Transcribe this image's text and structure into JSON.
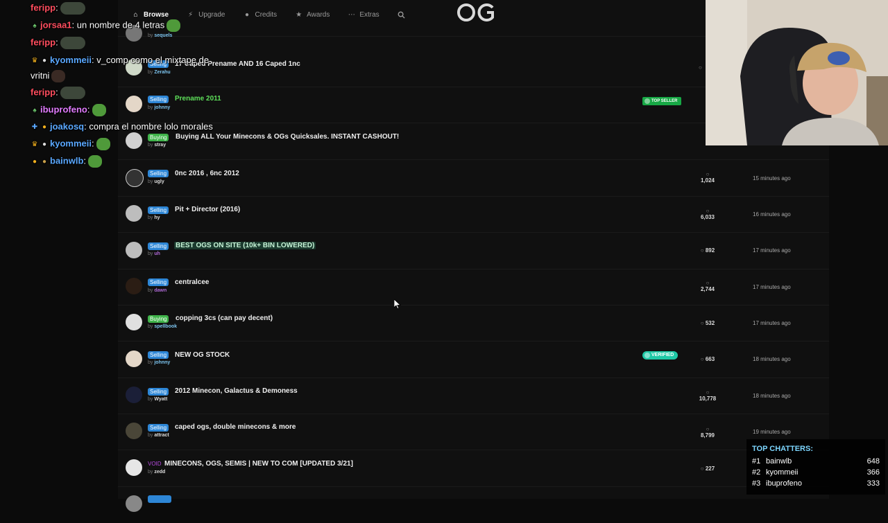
{
  "nav": {
    "items": [
      {
        "label": "Browse",
        "icon": "home-icon"
      },
      {
        "label": "Upgrade",
        "icon": "bolt-icon"
      },
      {
        "label": "Credits",
        "icon": "coins-icon"
      },
      {
        "label": "Awards",
        "icon": "trophy-icon"
      },
      {
        "label": "Extras",
        "icon": "dots-icon"
      }
    ],
    "search_icon": "search-icon",
    "logo_text": "OG"
  },
  "threads": [
    {
      "tag": "",
      "title": "",
      "author": "sequels",
      "replies": "",
      "time": ""
    },
    {
      "tag": "Selling",
      "title": "17 Caped Prename AND 16 Caped 1nc",
      "author": "Zerahu",
      "replies": "",
      "time": ""
    },
    {
      "tag": "Selling",
      "title": "Prename 2011",
      "author": "johnny",
      "replies": "",
      "time": "",
      "badge": "TOP SELLER"
    },
    {
      "tag": "Buying",
      "title": "Buying ALL Your Minecons & OGs Quicksales. INSTANT CASHOUT!",
      "author": "stray",
      "replies": "",
      "time": ""
    },
    {
      "tag": "Selling",
      "title": "0nc 2016 , 6nc 2012",
      "author": "ugly",
      "replies": "1,024",
      "time": "15 minutes ago"
    },
    {
      "tag": "Selling",
      "title": "Pit + Director (2016)",
      "author": "hy",
      "replies": "6,033",
      "time": "16 minutes ago"
    },
    {
      "tag": "Selling",
      "title": "BEST OGS ON SITE (10k+ BIN LOWERED)",
      "author": "uh",
      "replies": "892",
      "time": "17 minutes ago"
    },
    {
      "tag": "Selling",
      "title": "centralcee",
      "author": "dawn",
      "replies": "2,744",
      "time": "17 minutes ago"
    },
    {
      "tag": "Buying",
      "title": "copping 3cs (can pay decent)",
      "author": "spellbook",
      "replies": "532",
      "time": "17 minutes ago"
    },
    {
      "tag": "Selling",
      "title": "NEW OG STOCK",
      "author": "johnny",
      "replies": "663",
      "time": "18 minutes ago",
      "badge": "VERIFIED"
    },
    {
      "tag": "Selling",
      "title": "2012 Minecon, Galactus & Demoness",
      "author": "Wyatt",
      "replies": "10,778",
      "time": "18 minutes ago"
    },
    {
      "tag": "Selling",
      "title": "caped ogs, double minecons & more",
      "author": "attract",
      "replies": "8,799",
      "time": "19 minutes ago"
    },
    {
      "tag": "VOID",
      "title": "MINECONS, OGS, SEMIS | NEW TO COM [UPDATED 3/21]",
      "author": "zedd",
      "replies": "227",
      "time": ""
    }
  ],
  "byline_prefix": "by",
  "chat": [
    {
      "user": "feripp",
      "sep": ":",
      "msg": "",
      "user_color": "#ff4d5e"
    },
    {
      "user": "jorsaa1",
      "sep": ":",
      "msg": " un nombre de 4 letras",
      "user_color": "#ff4d5e"
    },
    {
      "user": "feripp",
      "sep": ":",
      "msg": "",
      "user_color": "#ff4d5e"
    },
    {
      "user": "kyommeii",
      "sep": ":",
      "msg": " v_comp como el mixtape de",
      "user_color": "#5aa8ff"
    },
    {
      "user": "",
      "sep": "",
      "msg": "vritni",
      "user_color": "#ffffff"
    },
    {
      "user": "feripp",
      "sep": ":",
      "msg": "",
      "user_color": "#ff4d5e"
    },
    {
      "user": "ibuprofeno",
      "sep": ":",
      "msg": "",
      "user_color": "#e27cff"
    },
    {
      "user": "joakosq",
      "sep": ":",
      "msg": " compra el nombre lolo morales",
      "user_color": "#5aa8ff"
    },
    {
      "user": "kyommeii",
      "sep": ":",
      "msg": "",
      "user_color": "#5aa8ff"
    },
    {
      "user": "bainwlb",
      "sep": ":",
      "msg": "",
      "user_color": "#5aa8ff"
    }
  ],
  "top_chatters": {
    "title": "TOP CHATTERS:",
    "rows": [
      {
        "rank": "#1",
        "name": "bainwlb",
        "count": "648"
      },
      {
        "rank": "#2",
        "name": "kyommeii",
        "count": "366"
      },
      {
        "rank": "#3",
        "name": "ibuprofeno",
        "count": "333"
      }
    ]
  },
  "colors": {
    "selling": "#2d86d6",
    "buying": "#3fb34a",
    "void": "#b64ae0",
    "top_seller": "#17a845",
    "verified": "#1fc9a6",
    "chatters_title": "#7dd6ff"
  }
}
